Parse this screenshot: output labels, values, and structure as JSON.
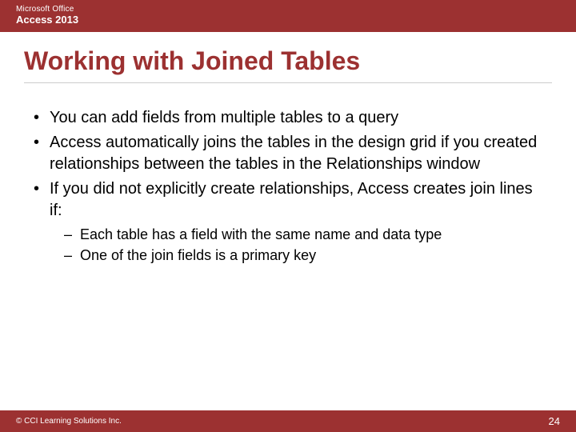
{
  "header": {
    "line1": "Microsoft Office",
    "line2": "Access 2013"
  },
  "title": "Working with Joined Tables",
  "bullets": [
    {
      "text": "You can add fields from multiple tables to a query"
    },
    {
      "text": "Access automatically joins the tables in the design grid if you created relationships between the tables in the Relationships window"
    },
    {
      "text": "If you did not explicitly create relationships, Access creates join lines if:",
      "sub": [
        "Each table has a field with the same name and data type",
        "One of the join fields is a primary key"
      ]
    }
  ],
  "footer": {
    "copyright": "© CCI Learning Solutions Inc.",
    "page": "24"
  }
}
